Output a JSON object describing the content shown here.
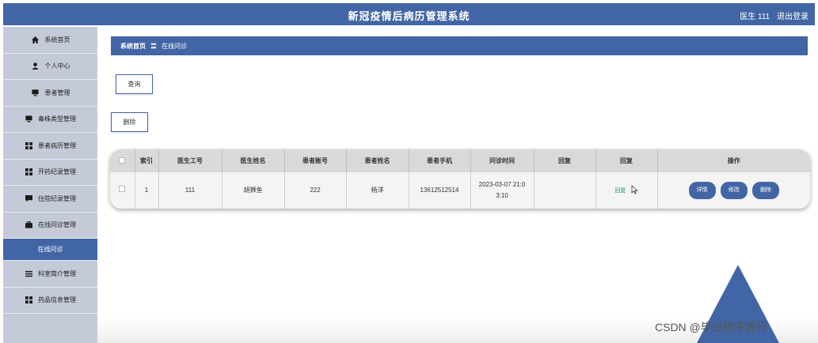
{
  "app": {
    "title": "新冠疫情后病历管理系统",
    "user_label": "医生 111",
    "logout_label": "退出登录"
  },
  "sidebar": {
    "items": [
      {
        "label": "系统首页",
        "icon": "home-icon"
      },
      {
        "label": "个人中心",
        "icon": "user-icon"
      },
      {
        "label": "患者管理",
        "icon": "monitor-icon"
      },
      {
        "label": "毒株类型管理",
        "icon": "monitor-icon"
      },
      {
        "label": "患者病历管理",
        "icon": "grid-icon"
      },
      {
        "label": "开药纪录管理",
        "icon": "grid-icon"
      },
      {
        "label": "住院纪录管理",
        "icon": "chat-icon"
      },
      {
        "label": "在线问诊管理",
        "icon": "briefcase-icon"
      },
      {
        "label": "在线问诊",
        "icon": ""
      },
      {
        "label": "科室简介管理",
        "icon": "list-icon"
      },
      {
        "label": "药品信息管理",
        "icon": "grid-icon"
      }
    ]
  },
  "breadcrumb": {
    "home": "系统首页",
    "separator": "〓",
    "current": "在线问诊"
  },
  "toolbar": {
    "query_label": "查询",
    "delete_label": "删除"
  },
  "table": {
    "headers": [
      "索引",
      "医生工号",
      "医生姓名",
      "患者账号",
      "患者姓名",
      "患者手机",
      "问诊时间",
      "回复",
      "回复",
      "操作"
    ],
    "rows": [
      {
        "index": "1",
        "doctor_id": "111",
        "doctor_name": "胡狮鱼",
        "patient_account": "222",
        "patient_name": "杨洋",
        "patient_phone": "13612512514",
        "time_line1": "2023-03-07 21:0",
        "time_line2": "3:10",
        "reply_text": "",
        "reply_link": "回复",
        "actions": {
          "detail": "详情",
          "edit": "修改",
          "delete": "删除"
        }
      }
    ]
  },
  "watermark": "CSDN @毕设程序源码",
  "colors": {
    "primary": "#4266a5",
    "sidebar_bg": "#c4cad7",
    "reply_link": "#1e9e6a"
  }
}
